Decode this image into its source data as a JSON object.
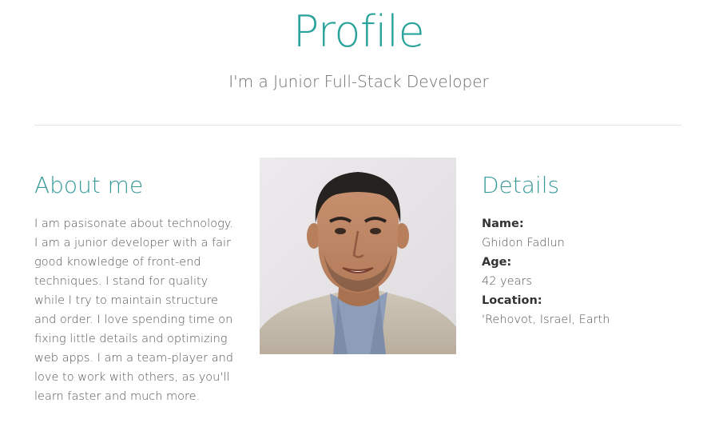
{
  "header": {
    "title": "Profile",
    "subtitle": "I'm a Junior Full-Stack Developer"
  },
  "about": {
    "heading": "About me",
    "text": "I am pasisonate about technology. I am a junior developer with a fair good knowledge of front-end techniques. I stand for quality while I try to maintain structure and order. I love spending time on fixing little details and optimizing web apps. I am a team-player and love to work with others, as you'll learn faster and much more."
  },
  "photo": {
    "icon": "profile-photo"
  },
  "details": {
    "heading": "Details",
    "name_label": "Name:",
    "name_value": "Ghidon Fadlun",
    "age_label": "Age:",
    "age_value": "42 years",
    "location_label": "Location:",
    "location_value": "'Rehovot, Israel, Earth"
  },
  "colors": {
    "accent": "#2aa39b",
    "heading": "#3a9a9a",
    "text": "#555555"
  }
}
